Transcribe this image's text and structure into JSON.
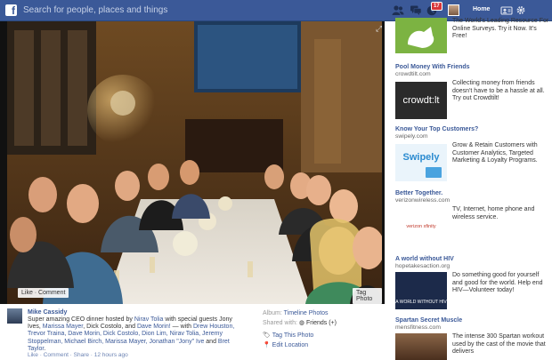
{
  "topbar": {
    "logo_letter": "f",
    "search_placeholder": "Search for people, places and things",
    "notification_count": "17",
    "home_label": "Home"
  },
  "photo": {
    "like_comment_label": "Like · Comment",
    "tag_photo_label": "Tag Photo"
  },
  "caption": {
    "author": "Mike Cassidy",
    "text_parts": {
      "p1": "Super amazing CEO dinner hosted by ",
      "host": "Nirav Tolia",
      "p2": " with special guests Jony Ives, ",
      "g1": "Marissa Mayer",
      "p3": ", Dick Costolo, and ",
      "g2": "Dave Morin!",
      "p4": " — with ",
      "w1": "Drew Houston, Trevor Traina, Dave Morin, Dick Costolo, Dion Lim, Nirav Tolia, Jeremy Stoppelman, Michael Birch, Marissa Mayer, Jonathan \"Jony\" Ive",
      "p5": " and ",
      "w2": "Bret Taylor",
      "p6": "."
    },
    "meta": "Like · Comment · Share · 12 hours ago",
    "album_label": "Album:",
    "album_value": "Timeline Photos",
    "shared_label": "Shared with:",
    "shared_value": "Friends (+)",
    "tag_this_photo": "Tag This Photo",
    "edit_location": "Edit Location"
  },
  "ads": [
    {
      "title": "",
      "url": "",
      "body": "Resource For Online Surveys. Try it Now. It's Free!",
      "body_lead": "The World's Leading",
      "img_label": "",
      "img_color": "#7cb342"
    },
    {
      "title": "Pool Money With Friends",
      "url": "crowdtilt.com",
      "body": "Collecting money from friends doesn't have to be a hassle at all. Try out Crowdtilt!",
      "img_label": "crowdt:lt",
      "img_color": "#2b2b2b"
    },
    {
      "title": "Know Your Top Customers?",
      "url": "swipely.com",
      "body": "Grow & Retain Customers with Customer Analytics, Targeted Marketing & Loyalty Programs.",
      "img_label": "Swipely",
      "img_color": "#4aa3df"
    },
    {
      "title": "Better Together.",
      "url": "verizonwireless.com",
      "body": "TV, Internet, home phone and wireless service.",
      "img_label": "verizon  xfinity",
      "img_color": "#ffffff"
    },
    {
      "title": "A world without HIV",
      "url": "hopetakesaction.org",
      "body": "Do something good for yourself and good for the world. Help end HIV—Volunteer today!",
      "img_label": "A WORLD WITHOUT HIV",
      "img_color": "#1c2a4a"
    },
    {
      "title": "Spartan Secret Muscle",
      "url": "mensfitness.com",
      "body": "The intense 300 Spartan workout used by the cast of the movie that delivers",
      "img_label": "",
      "img_color": "#6b4a34"
    }
  ],
  "colors": {
    "brand": "#3b5998",
    "badge": "#d8363a"
  },
  "icons": [
    "facebook-logo-icon",
    "friend-requests-icon",
    "messages-icon",
    "notifications-icon",
    "account-icon",
    "settings-gear-icon",
    "expand-icon",
    "tag-icon",
    "location-pin-icon",
    "globe-icon"
  ]
}
